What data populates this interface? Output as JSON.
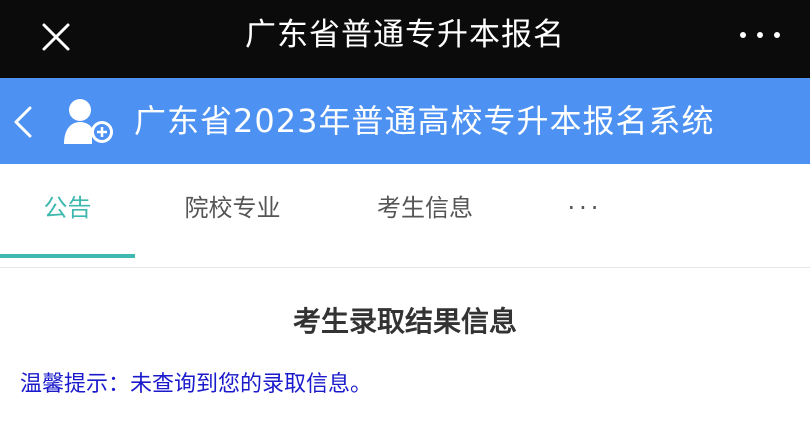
{
  "window": {
    "title": "广东省普通专升本报名"
  },
  "header": {
    "title": "广东省2023年普通高校专升本报名系统"
  },
  "tabs": [
    {
      "label": "公告",
      "active": true
    },
    {
      "label": "院校专业",
      "active": false
    },
    {
      "label": "考生信息",
      "active": false
    },
    {
      "label": "···",
      "active": false
    }
  ],
  "main": {
    "title": "考生录取结果信息",
    "notice": "温馨提示：未查询到您的录取信息。"
  },
  "colors": {
    "titlebar_bg": "#0b0b0b",
    "appbar_bg": "#4d92f2",
    "tab_active": "#3fb8b0",
    "notice_text": "#1a1acc"
  }
}
